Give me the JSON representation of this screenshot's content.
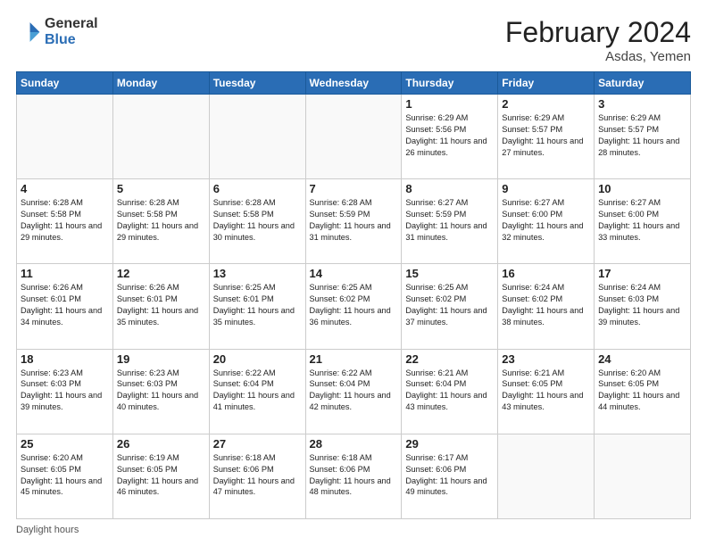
{
  "logo": {
    "general": "General",
    "blue": "Blue"
  },
  "header": {
    "title": "February 2024",
    "location": "Asdas, Yemen"
  },
  "weekdays": [
    "Sunday",
    "Monday",
    "Tuesday",
    "Wednesday",
    "Thursday",
    "Friday",
    "Saturday"
  ],
  "footer": {
    "daylight_label": "Daylight hours"
  },
  "weeks": [
    [
      {
        "day": "",
        "info": ""
      },
      {
        "day": "",
        "info": ""
      },
      {
        "day": "",
        "info": ""
      },
      {
        "day": "",
        "info": ""
      },
      {
        "day": "1",
        "info": "Sunrise: 6:29 AM\nSunset: 5:56 PM\nDaylight: 11 hours and 26 minutes."
      },
      {
        "day": "2",
        "info": "Sunrise: 6:29 AM\nSunset: 5:57 PM\nDaylight: 11 hours and 27 minutes."
      },
      {
        "day": "3",
        "info": "Sunrise: 6:29 AM\nSunset: 5:57 PM\nDaylight: 11 hours and 28 minutes."
      }
    ],
    [
      {
        "day": "4",
        "info": "Sunrise: 6:28 AM\nSunset: 5:58 PM\nDaylight: 11 hours and 29 minutes."
      },
      {
        "day": "5",
        "info": "Sunrise: 6:28 AM\nSunset: 5:58 PM\nDaylight: 11 hours and 29 minutes."
      },
      {
        "day": "6",
        "info": "Sunrise: 6:28 AM\nSunset: 5:58 PM\nDaylight: 11 hours and 30 minutes."
      },
      {
        "day": "7",
        "info": "Sunrise: 6:28 AM\nSunset: 5:59 PM\nDaylight: 11 hours and 31 minutes."
      },
      {
        "day": "8",
        "info": "Sunrise: 6:27 AM\nSunset: 5:59 PM\nDaylight: 11 hours and 31 minutes."
      },
      {
        "day": "9",
        "info": "Sunrise: 6:27 AM\nSunset: 6:00 PM\nDaylight: 11 hours and 32 minutes."
      },
      {
        "day": "10",
        "info": "Sunrise: 6:27 AM\nSunset: 6:00 PM\nDaylight: 11 hours and 33 minutes."
      }
    ],
    [
      {
        "day": "11",
        "info": "Sunrise: 6:26 AM\nSunset: 6:01 PM\nDaylight: 11 hours and 34 minutes."
      },
      {
        "day": "12",
        "info": "Sunrise: 6:26 AM\nSunset: 6:01 PM\nDaylight: 11 hours and 35 minutes."
      },
      {
        "day": "13",
        "info": "Sunrise: 6:25 AM\nSunset: 6:01 PM\nDaylight: 11 hours and 35 minutes."
      },
      {
        "day": "14",
        "info": "Sunrise: 6:25 AM\nSunset: 6:02 PM\nDaylight: 11 hours and 36 minutes."
      },
      {
        "day": "15",
        "info": "Sunrise: 6:25 AM\nSunset: 6:02 PM\nDaylight: 11 hours and 37 minutes."
      },
      {
        "day": "16",
        "info": "Sunrise: 6:24 AM\nSunset: 6:02 PM\nDaylight: 11 hours and 38 minutes."
      },
      {
        "day": "17",
        "info": "Sunrise: 6:24 AM\nSunset: 6:03 PM\nDaylight: 11 hours and 39 minutes."
      }
    ],
    [
      {
        "day": "18",
        "info": "Sunrise: 6:23 AM\nSunset: 6:03 PM\nDaylight: 11 hours and 39 minutes."
      },
      {
        "day": "19",
        "info": "Sunrise: 6:23 AM\nSunset: 6:03 PM\nDaylight: 11 hours and 40 minutes."
      },
      {
        "day": "20",
        "info": "Sunrise: 6:22 AM\nSunset: 6:04 PM\nDaylight: 11 hours and 41 minutes."
      },
      {
        "day": "21",
        "info": "Sunrise: 6:22 AM\nSunset: 6:04 PM\nDaylight: 11 hours and 42 minutes."
      },
      {
        "day": "22",
        "info": "Sunrise: 6:21 AM\nSunset: 6:04 PM\nDaylight: 11 hours and 43 minutes."
      },
      {
        "day": "23",
        "info": "Sunrise: 6:21 AM\nSunset: 6:05 PM\nDaylight: 11 hours and 43 minutes."
      },
      {
        "day": "24",
        "info": "Sunrise: 6:20 AM\nSunset: 6:05 PM\nDaylight: 11 hours and 44 minutes."
      }
    ],
    [
      {
        "day": "25",
        "info": "Sunrise: 6:20 AM\nSunset: 6:05 PM\nDaylight: 11 hours and 45 minutes."
      },
      {
        "day": "26",
        "info": "Sunrise: 6:19 AM\nSunset: 6:05 PM\nDaylight: 11 hours and 46 minutes."
      },
      {
        "day": "27",
        "info": "Sunrise: 6:18 AM\nSunset: 6:06 PM\nDaylight: 11 hours and 47 minutes."
      },
      {
        "day": "28",
        "info": "Sunrise: 6:18 AM\nSunset: 6:06 PM\nDaylight: 11 hours and 48 minutes."
      },
      {
        "day": "29",
        "info": "Sunrise: 6:17 AM\nSunset: 6:06 PM\nDaylight: 11 hours and 49 minutes."
      },
      {
        "day": "",
        "info": ""
      },
      {
        "day": "",
        "info": ""
      }
    ]
  ]
}
